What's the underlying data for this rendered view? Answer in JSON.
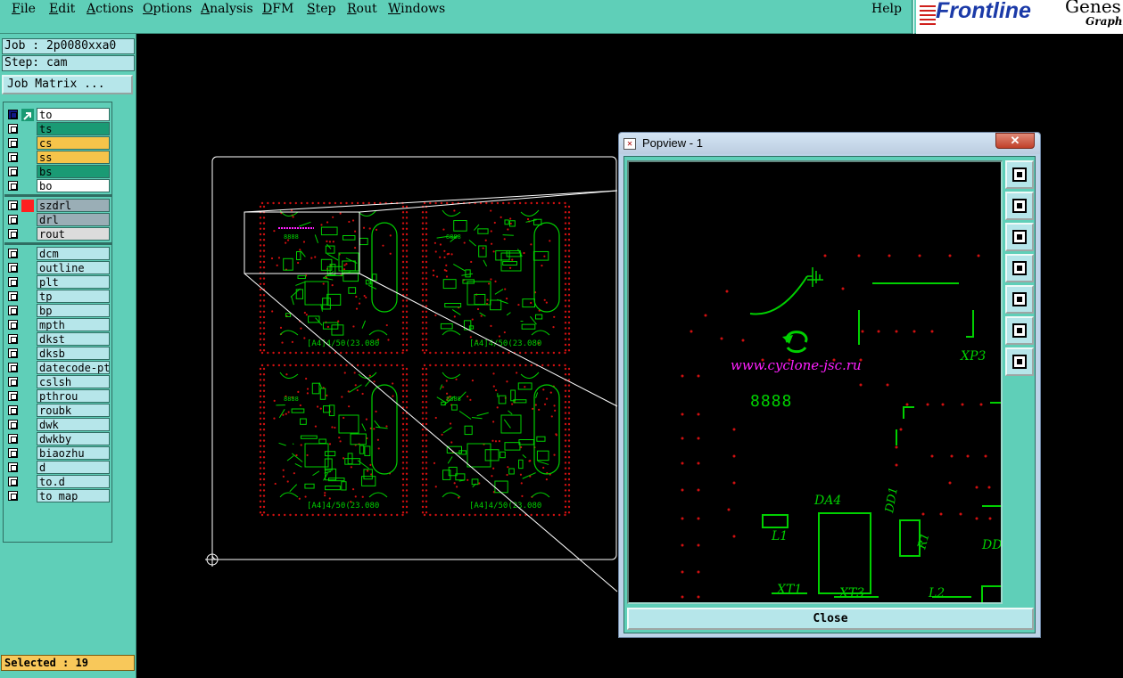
{
  "menubar": {
    "items": [
      {
        "label": "File",
        "underline": "F",
        "rest": "ile"
      },
      {
        "label": "Edit",
        "underline": "E",
        "rest": "dit"
      },
      {
        "label": "Actions",
        "underline": "A",
        "rest": "ctions"
      },
      {
        "label": "Options",
        "underline": "O",
        "rest": "ptions"
      },
      {
        "label": "Analysis",
        "underline": "A",
        "rest": "nalysis"
      },
      {
        "label": "DFM",
        "underline": "D",
        "rest": "FM"
      },
      {
        "label": "Step",
        "underline": "S",
        "rest": "tep"
      },
      {
        "label": "Rout",
        "underline": "R",
        "rest": "out"
      },
      {
        "label": "Windows",
        "underline": "W",
        "rest": "indows"
      }
    ],
    "help": "Help",
    "logo": "Frontline",
    "logo_cut": "Genes",
    "logo_sub": "Graphi"
  },
  "left_panel": {
    "job": "Job : 2p0080xxa0",
    "step": "Step: cam",
    "job_matrix_button": "Job Matrix ...",
    "selected": "Selected : 19",
    "layer_groups": [
      {
        "layers": [
          {
            "name": "to",
            "color": "#ffffff",
            "active": true
          },
          {
            "name": "ts",
            "color": "#1a9a74"
          },
          {
            "name": "cs",
            "color": "#f6c44a"
          },
          {
            "name": "ss",
            "color": "#f6c44a"
          },
          {
            "name": "bs",
            "color": "#1a9a74"
          },
          {
            "name": "bo",
            "color": "#ffffff"
          }
        ]
      },
      {
        "layers": [
          {
            "name": "szdrl",
            "color": "#9aaeb6",
            "mark": "#ff2020"
          },
          {
            "name": "drl",
            "color": "#9aaeb6"
          },
          {
            "name": "rout",
            "color": "#dcdcdc"
          }
        ]
      },
      {
        "layers": [
          {
            "name": "dcm",
            "color": "#b6e6ea"
          },
          {
            "name": "outline",
            "color": "#b6e6ea"
          },
          {
            "name": "plt",
            "color": "#b6e6ea"
          },
          {
            "name": "tp",
            "color": "#b6e6ea"
          },
          {
            "name": "bp",
            "color": "#b6e6ea"
          },
          {
            "name": "mpth",
            "color": "#b6e6ea"
          },
          {
            "name": "dkst",
            "color": "#b6e6ea"
          },
          {
            "name": "dksb",
            "color": "#b6e6ea"
          },
          {
            "name": "datecode-pto",
            "color": "#b6e6ea"
          },
          {
            "name": "cslsh",
            "color": "#b6e6ea"
          },
          {
            "name": "pthrou",
            "color": "#b6e6ea"
          },
          {
            "name": "roubk",
            "color": "#b6e6ea"
          },
          {
            "name": "dwk",
            "color": "#b6e6ea"
          },
          {
            "name": "dwkby",
            "color": "#b6e6ea"
          },
          {
            "name": "biaozhu",
            "color": "#b6e6ea"
          },
          {
            "name": "d",
            "color": "#b6e6ea"
          },
          {
            "name": "to.d",
            "color": "#b6e6ea"
          },
          {
            "name": "to_map",
            "color": "#b6e6ea"
          }
        ]
      }
    ]
  },
  "canvas": {
    "board_label": "[A4]4/50(23.080",
    "counter_label": "8888"
  },
  "popview": {
    "title": "Popview - 1",
    "close_button": "Close",
    "tools": [
      "zoom-fit-icon",
      "pan-up-icon",
      "pan-down-icon",
      "pan-left-icon",
      "pan-right-icon",
      "zoom-in-icon",
      "zoom-out-icon"
    ],
    "view_labels": {
      "url": "www.cyclone-jsc.ru",
      "counter": "8888",
      "xp3": "XP3",
      "da4": "DA4",
      "dd1": "DD1",
      "l1": "L1",
      "r1": "R1",
      "dd": "DD",
      "xt1": "XT1",
      "xt3": "XT3",
      "l2": "L2"
    }
  },
  "colors": {
    "copper": "#00d000",
    "drill": "#d01010",
    "silk": "#ff20ff",
    "profile": "#ffffff"
  }
}
